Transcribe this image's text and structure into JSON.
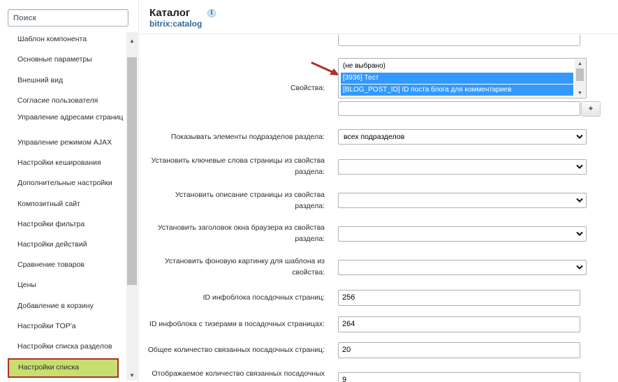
{
  "sidebar": {
    "search_placeholder": "Поиск",
    "items": [
      {
        "label": "Шаблон компонента"
      },
      {
        "label": "Основные параметры"
      },
      {
        "label": "Внешний вид"
      },
      {
        "label": "Согласие пользователя"
      },
      {
        "label": "Управление адресами страниц"
      },
      {
        "label": "Управление режимом AJAX"
      },
      {
        "label": "Настройки кеширования"
      },
      {
        "label": "Дополнительные настройки"
      },
      {
        "label": "Композитный сайт"
      },
      {
        "label": "Настройки фильтра"
      },
      {
        "label": "Настройки действий"
      },
      {
        "label": "Сравнение товаров"
      },
      {
        "label": "Цены"
      },
      {
        "label": "Добавление в корзину"
      },
      {
        "label": "Настройки TOP'а"
      },
      {
        "label": "Настройки списка разделов"
      },
      {
        "label": "Настройки списка"
      }
    ],
    "active_item": "Настройки списка"
  },
  "header": {
    "title": "Каталог",
    "subtitle": "bitrix:catalog",
    "info_icon": "i"
  },
  "form": {
    "properties": {
      "label": "Свойства:",
      "options": [
        {
          "label": "(не выбрано)",
          "selected": false
        },
        {
          "label": "[3936] Тест",
          "selected": true
        },
        {
          "label": "[BLOG_POST_ID] ID поста блога для комментариев",
          "selected": true
        }
      ],
      "extra_value": "",
      "add_label": "+"
    },
    "show_subsections": {
      "label": "Показывать элементы подразделов раздела:",
      "value": "всех подразделов"
    },
    "keywords": {
      "label_line1": "Установить ключевые слова страницы из свойства",
      "label_line2": "раздела:",
      "value": ""
    },
    "description": {
      "label_line1": "Установить описание страницы из свойства",
      "label_line2": "раздела:",
      "value": ""
    },
    "browser_title": {
      "label_line1": "Установить заголовок окна браузера из свойства",
      "label_line2": "раздела:",
      "value": ""
    },
    "background": {
      "label_line1": "Установить фоновую картинку для шаблона из",
      "label_line2": "свойства:",
      "value": ""
    },
    "landing_iblock": {
      "label": "ID инфоблока посадочных страниц:",
      "value": "256"
    },
    "teaser_iblock": {
      "label": "ID инфоблока с тизерами в посадочных страницах:",
      "value": "264"
    },
    "total_linked": {
      "label": "Общее количество связанных посадочных страниц:",
      "value": "20"
    },
    "shown_linked": {
      "label": "Отображаемое количество связанных посадочных",
      "value": "9"
    }
  },
  "colors": {
    "accent_text": "#2f6a9a",
    "selection": "#3399ff",
    "active_item_bg": "#c6df70",
    "active_item_border": "#b0302a",
    "arrow": "#b0302a"
  }
}
